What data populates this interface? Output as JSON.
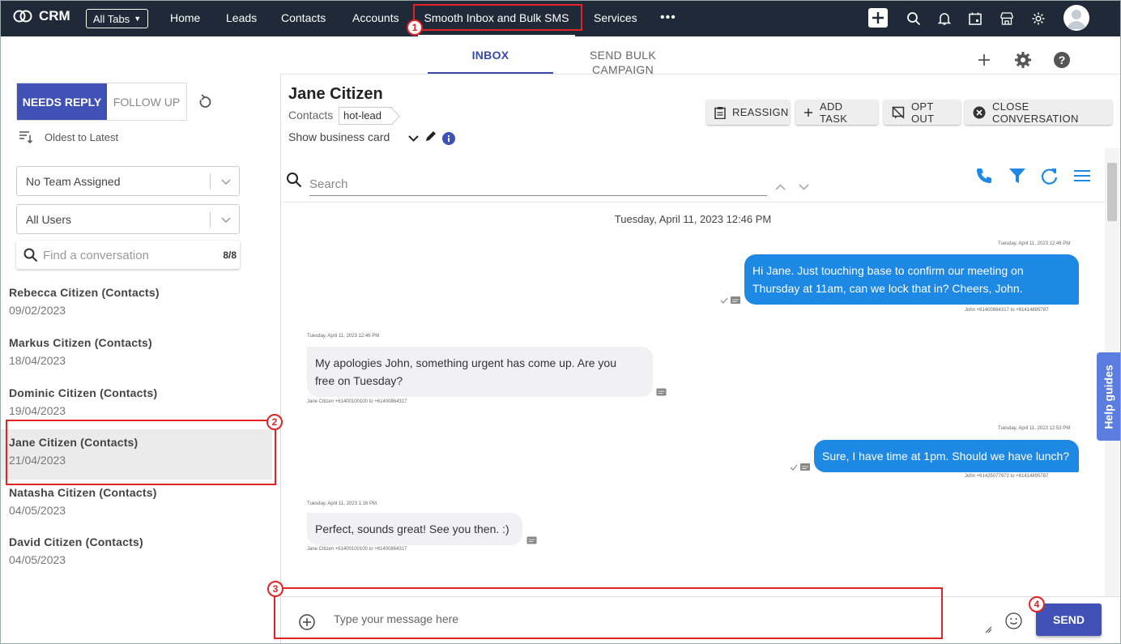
{
  "topnav": {
    "brand": "CRM",
    "all_tabs": "All Tabs",
    "items": [
      {
        "label": "Home"
      },
      {
        "label": "Leads"
      },
      {
        "label": "Contacts"
      },
      {
        "label": "Accounts"
      },
      {
        "label": "Smooth Inbox and Bulk SMS"
      },
      {
        "label": "Services"
      }
    ],
    "more": "•••"
  },
  "tabs": [
    {
      "label": "INBOX"
    },
    {
      "label": "SEND BULK CAMPAIGN"
    }
  ],
  "annotations": [
    "1",
    "2",
    "3",
    "4"
  ],
  "left": {
    "filter_needs_reply": "NEEDS REPLY",
    "filter_follow_up": "FOLLOW UP",
    "sort_label": "Oldest to Latest",
    "team_select": "No Team Assigned",
    "user_select": "All Users",
    "search_placeholder": "Find a conversation",
    "search_count": "8/8",
    "conversations": [
      {
        "name": "Rebecca Citizen (Contacts)",
        "date": "09/02/2023"
      },
      {
        "name": "Markus Citizen (Contacts)",
        "date": "18/04/2023"
      },
      {
        "name": "Dominic Citizen (Contacts)",
        "date": "19/04/2023"
      },
      {
        "name": "Jane Citizen (Contacts)",
        "date": "21/04/2023"
      },
      {
        "name": "Natasha Citizen (Contacts)",
        "date": "04/05/2023"
      },
      {
        "name": "David Citizen (Contacts)",
        "date": "04/05/2023"
      }
    ]
  },
  "contact": {
    "name": "Jane Citizen",
    "module": "Contacts",
    "tag": "hot-lead",
    "show_card": "Show business card"
  },
  "actions": {
    "reassign": "REASSIGN",
    "add_task": "ADD TASK",
    "opt_out": "OPT OUT",
    "close": "CLOSE CONVERSATION"
  },
  "chat": {
    "search_placeholder": "Search",
    "date_separator": "Tuesday, April 11, 2023 12:46 PM",
    "messages": [
      {
        "direction": "outgoing",
        "time": "Tuesday, April 11, 2023 12:46 PM",
        "line1": "Hi Jane. Just touching base to confirm our meeting on",
        "line2": "Thursday at 11am, can we lock that in? Cheers, John.",
        "meta": "John +61400864317 to +61414895787"
      },
      {
        "direction": "incoming",
        "time": "Tuesday, April 11, 2023 12:46 PM",
        "line1": "My apologies John, something urgent has come up. Are you",
        "line2": "free on Tuesday?",
        "meta": "Jane Citizen +61400100100 to +61400864317"
      },
      {
        "direction": "outgoing",
        "time": "Tuesday, April 11, 2023 12:53 PM",
        "line1": "Sure, I have time at 1pm. Should we have lunch?",
        "meta": "John +61425077972 to +61414895787"
      },
      {
        "direction": "incoming",
        "time": "Tuesday, April 11, 2023 1:16 PM",
        "line1": "Perfect, sounds great! See you then. :)",
        "meta": "Jane Citizen +61400100100 to +61400864317"
      }
    ]
  },
  "composer": {
    "placeholder": "Type your message here",
    "send": "SEND"
  },
  "help_guides": "Help guides",
  "colors": {
    "primary": "#3f51b5",
    "bubble_out": "#1e88e5",
    "topbar": "#1f2937",
    "annotation": "#e02424"
  }
}
